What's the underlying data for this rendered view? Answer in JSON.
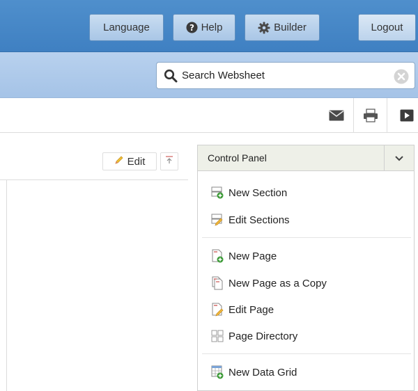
{
  "header": {
    "language_label": "Language",
    "help_label": "Help",
    "builder_label": "Builder",
    "logout_label": "Logout"
  },
  "search": {
    "placeholder": "Search Websheet"
  },
  "toolbar": {
    "icons": [
      "mail-icon",
      "print-icon",
      "presentation-icon"
    ]
  },
  "content": {
    "edit_label": "Edit"
  },
  "control_panel": {
    "title": "Control Panel",
    "groups": [
      [
        {
          "label": "New Section",
          "icon": "new-section-icon"
        },
        {
          "label": "Edit Sections",
          "icon": "edit-sections-icon"
        }
      ],
      [
        {
          "label": "New Page",
          "icon": "new-page-icon"
        },
        {
          "label": "New Page as a Copy",
          "icon": "copy-page-icon"
        },
        {
          "label": "Edit Page",
          "icon": "edit-page-icon"
        },
        {
          "label": "Page Directory",
          "icon": "page-directory-icon"
        }
      ],
      [
        {
          "label": "New Data Grid",
          "icon": "data-grid-icon"
        }
      ]
    ]
  },
  "colors": {
    "header_blue": "#4586c8",
    "search_band": "#afcaeb",
    "panel_header": "#eef0e8"
  }
}
